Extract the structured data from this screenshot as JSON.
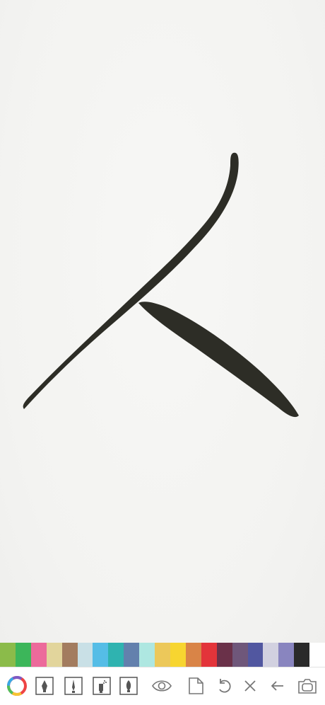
{
  "palette": {
    "colors": [
      "#8bbb4a",
      "#3cb65a",
      "#ec6a9b",
      "#e2d59c",
      "#a37c5f",
      "#c9e0e6",
      "#55bde6",
      "#2fb3b0",
      "#6380ad",
      "#aee7e1",
      "#ecc85a",
      "#f7d530",
      "#d98447",
      "#e3343a",
      "#6a3149",
      "#6f577a",
      "#5157a0",
      "#d2d1e0",
      "#8985bf",
      "#2a2a2a",
      "#ffffff"
    ],
    "selected_index": 19
  },
  "brush": {
    "ink_color": "#2d2d26"
  },
  "toolbar": {
    "tools": [
      {
        "name": "color-wheel-icon"
      },
      {
        "name": "pen-tool-icon"
      },
      {
        "name": "calligraphy-brush-icon"
      },
      {
        "name": "spray-brush-icon"
      },
      {
        "name": "ink-brush-icon"
      },
      {
        "name": "eye-icon"
      },
      {
        "name": "new-page-icon"
      },
      {
        "name": "undo-icon"
      },
      {
        "name": "clear-icon"
      },
      {
        "name": "back-arrow-icon"
      },
      {
        "name": "camera-icon"
      }
    ]
  }
}
